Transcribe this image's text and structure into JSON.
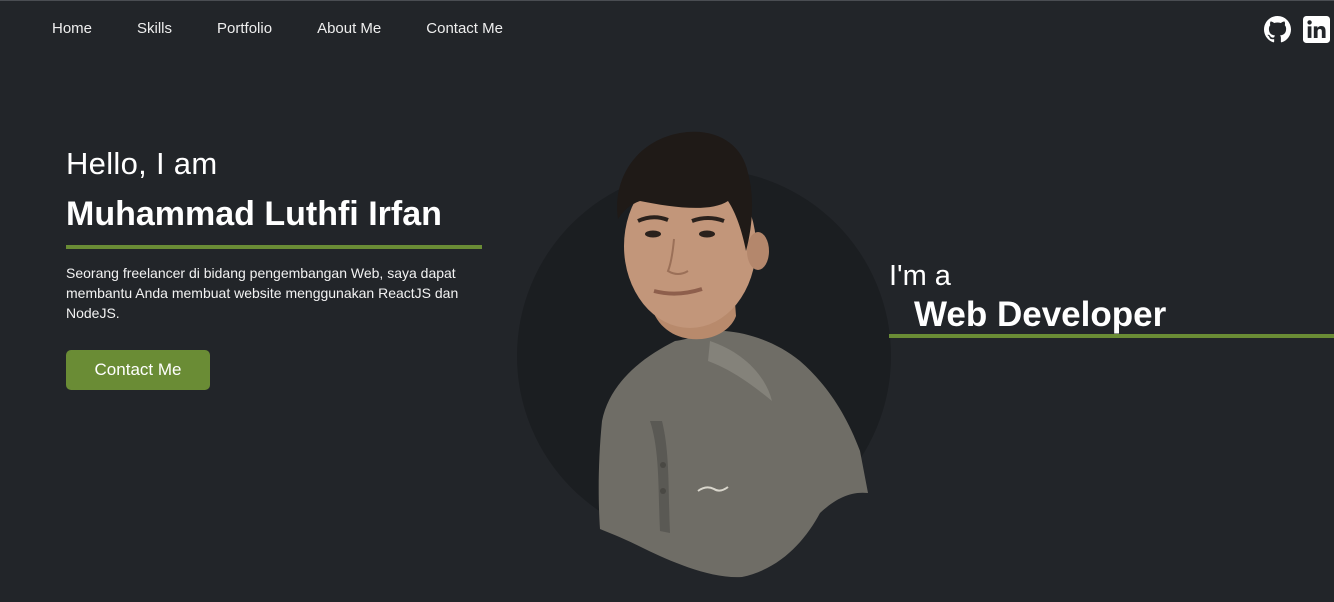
{
  "nav": {
    "links": [
      {
        "label": "Home"
      },
      {
        "label": "Skills"
      },
      {
        "label": "Portfolio"
      },
      {
        "label": "About Me"
      },
      {
        "label": "Contact Me"
      }
    ],
    "social": [
      {
        "icon": "github-icon"
      },
      {
        "icon": "linkedin-icon"
      }
    ]
  },
  "hero": {
    "greeting": "Hello, I am",
    "name": "Muhammad Luthfi Irfan",
    "description": "Seorang freelancer di bidang pengembangan Web, saya dapat membantu Anda membuat website menggunakan ReactJS dan NodeJS.",
    "cta_label": "Contact Me",
    "im_a": "I'm a",
    "role": "Web Developer"
  },
  "colors": {
    "background": "#222529",
    "accent": "#6a8c35",
    "portrait_circle": "#1b1e21",
    "hoodie": "#6f6d66"
  }
}
